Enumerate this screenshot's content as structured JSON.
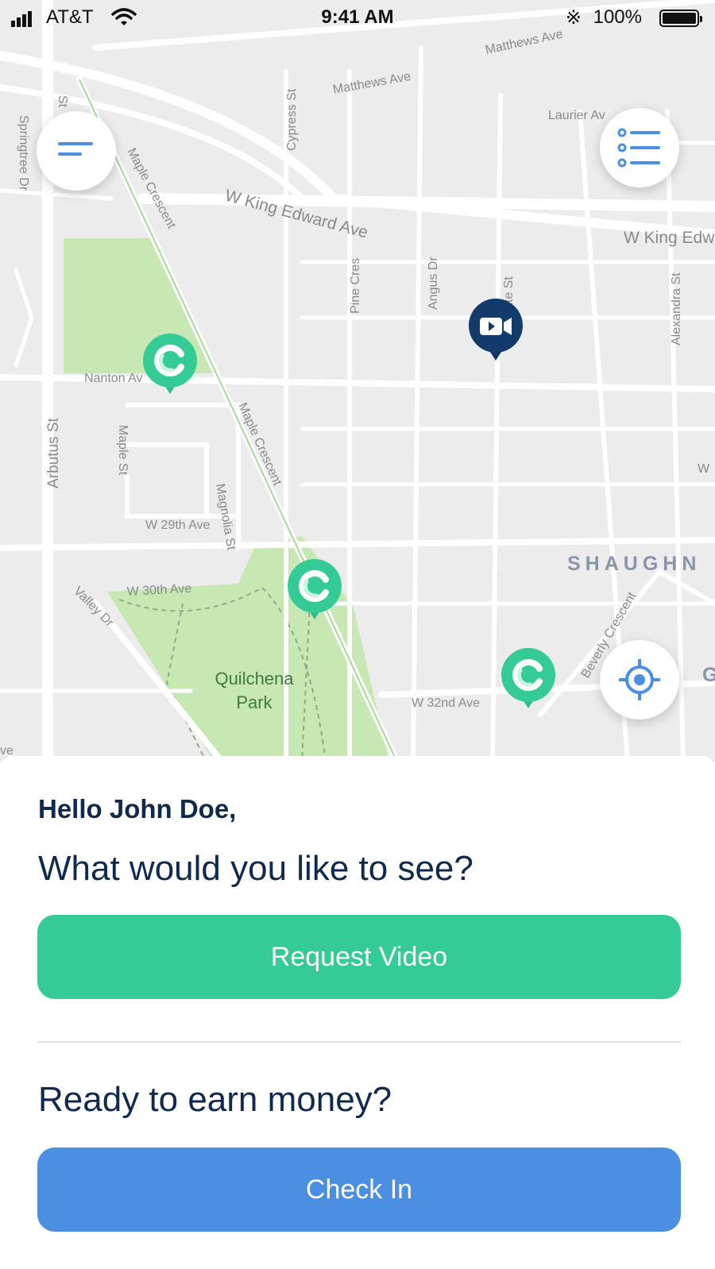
{
  "status_bar": {
    "carrier": "AT&T",
    "time": "9:41 AM",
    "battery": "100%"
  },
  "map": {
    "streets": {
      "matthews_ave": "Matthews Ave",
      "matthews_ave_2": "Matthews Ave",
      "laurier": "Laurier Av",
      "cypress": "Cypress St",
      "springtree": "Springtree Dr",
      "st": "St",
      "maple_crescent": "Maple Crescent",
      "maple_crescent_2": "Maple Crescent",
      "w_king_edward": "W King Edward Ave",
      "w_king_edward_2": "W King Edw",
      "pine_cres": "Pine Cres",
      "angus_dr": "Angus Dr",
      "rite_st": "rite St",
      "alexandra_st": "Alexandra St",
      "nanton": "Nanton Av",
      "arbutus": "Arbutus St",
      "maple_st": "Maple St",
      "magnolia": "Magnolia St",
      "w29": "W 29th Ave",
      "w30": "W 30th Ave",
      "valley": "Valley Dr",
      "w32": "W 32nd Ave",
      "beverly": "Beverly Crescent",
      "w_edge": "W",
      "ave_edge": "ve"
    },
    "park_name_line1": "Quilchena",
    "park_name_line2": "Park",
    "district": "SHAUGHN",
    "district_cut": "G"
  },
  "sheet": {
    "greeting": "Hello John Doe,",
    "question": "What would you like to see?",
    "request_button": "Request Video",
    "earn_question": "Ready to earn money?",
    "checkin_button": "Check In"
  },
  "colors": {
    "brand_navy": "#10294f",
    "green_button": "#34cb96",
    "blue_button": "#4b8fe2",
    "pin_green": "#34cb96",
    "pin_navy": "#123a6b",
    "icon_blue": "#4b8fe2",
    "park_green": "#c7e8b3"
  },
  "icons": {
    "menu": "menu-icon",
    "list": "list-icon",
    "locate": "crosshair-icon",
    "video_pin": "video-camera-icon",
    "green_pin": "refresh-icon"
  }
}
